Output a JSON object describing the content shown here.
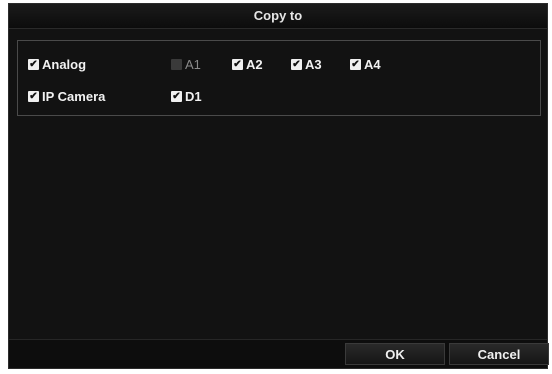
{
  "dialog": {
    "title": "Copy to"
  },
  "groups": [
    {
      "label": "Analog",
      "checked": true,
      "channels": [
        {
          "label": "A1",
          "checked": false,
          "disabled": true
        },
        {
          "label": "A2",
          "checked": true,
          "disabled": false
        },
        {
          "label": "A3",
          "checked": true,
          "disabled": false
        },
        {
          "label": "A4",
          "checked": true,
          "disabled": false
        }
      ]
    },
    {
      "label": "IP Camera",
      "checked": true,
      "channels": [
        {
          "label": "D1",
          "checked": true,
          "disabled": false
        }
      ]
    }
  ],
  "buttons": {
    "ok": "OK",
    "cancel": "Cancel"
  },
  "icons": {
    "checked": "check-mark-icon"
  }
}
